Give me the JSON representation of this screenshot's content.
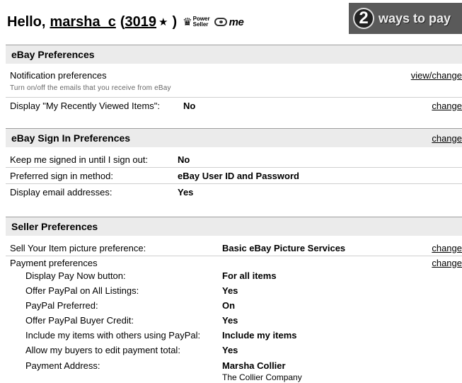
{
  "greeting": {
    "hello": "Hello,",
    "username": "marsha_c",
    "open_paren": "(",
    "feedback_score": "3019",
    "star": "★",
    "close_paren": ")",
    "power_seller_line1": "Power",
    "power_seller_line2": "Seller",
    "me_label": "me"
  },
  "promo": {
    "number": "2",
    "text": "ways to pay"
  },
  "ebay_prefs": {
    "title": "eBay Preferences",
    "notification_label": "Notification preferences",
    "notification_sub": "Turn on/off the emails that you receive from eBay",
    "notification_link": "view/change",
    "recent_label": "Display \"My Recently Viewed Items\":",
    "recent_value": "No",
    "recent_link": "change"
  },
  "signin_prefs": {
    "title": "eBay Sign In Preferences",
    "change": "change",
    "rows": [
      {
        "label": "Keep me signed in until I sign out:",
        "value": "No"
      },
      {
        "label": "Preferred sign in method:",
        "value": "eBay User ID and Password"
      },
      {
        "label": "Display email addresses:",
        "value": "Yes"
      }
    ]
  },
  "seller_prefs": {
    "title": "Seller Preferences",
    "picture_label": "Sell Your Item picture preference:",
    "picture_value": "Basic eBay Picture Services",
    "picture_link": "change",
    "payment_label": "Payment preferences",
    "payment_link": "change",
    "payment_rows": [
      {
        "label": "Display Pay Now button:",
        "value": "For all items"
      },
      {
        "label": "Offer PayPal on All Listings:",
        "value": "Yes"
      },
      {
        "label": "PayPal Preferred:",
        "value": "On"
      },
      {
        "label": "Offer PayPal Buyer Credit:",
        "value": "Yes"
      },
      {
        "label": "Include my items with others using PayPal:",
        "value": "Include my items"
      },
      {
        "label": "Allow my buyers to edit payment total:",
        "value": "Yes"
      },
      {
        "label": "Payment Address:",
        "value": "Marsha Collier"
      }
    ],
    "address_line2": "The Collier Company"
  }
}
